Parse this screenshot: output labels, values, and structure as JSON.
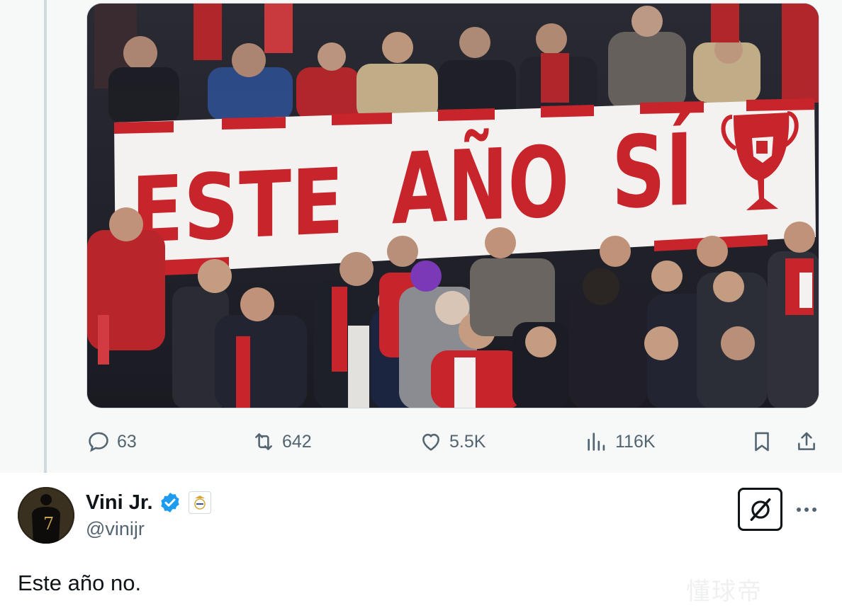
{
  "quoted_post": {
    "media": {
      "banner_words": [
        "ESTE",
        "AÑO",
        "SÍ"
      ],
      "banner_color": "#c8242b",
      "banner_background": "#f4f4f4"
    },
    "actions": {
      "replies": "63",
      "reposts": "642",
      "likes": "5.5K",
      "views": "116K"
    }
  },
  "reply": {
    "display_name": "Vini Jr.",
    "handle": "@vinijr",
    "verified": true,
    "affiliation_icon": "real-madrid-crest-icon",
    "text": "Este año no.",
    "avatar_icon": "player-silhouette-avatar",
    "avatar_jersey_number": "7"
  },
  "watermark": "懂球帝",
  "colors": {
    "text_primary": "#0f1419",
    "text_secondary": "#536471",
    "verified_blue": "#1d9bf0",
    "divider": "#cfd9de"
  }
}
